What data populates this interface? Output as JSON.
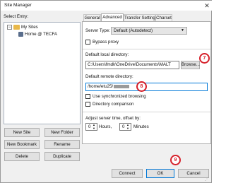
{
  "window": {
    "title": "Site Manager"
  },
  "sidebar": {
    "label": "Select Entry:",
    "tree": {
      "root": "My Sites",
      "child": "Home @ TECFA"
    },
    "buttons": {
      "new_site": "New Site",
      "new_folder": "New Folder",
      "new_bookmark": "New Bookmark",
      "rename": "Rename",
      "delete": "Delete",
      "duplicate": "Duplicate"
    }
  },
  "tabs": [
    "General",
    "Advanced",
    "Transfer Settings",
    "Charset"
  ],
  "active_tab": "Advanced",
  "advanced": {
    "server_type_label": "Server Type:",
    "server_type_value": "Default (Autodetect)",
    "bypass_proxy": "Bypass proxy",
    "local_dir_label": "Default local directory:",
    "local_dir_value": "C:\\Users\\fmdk\\OneDrive\\Documents\\MALT",
    "browse_button": "Browse...",
    "remote_dir_label": "Default remote directory:",
    "remote_dir_value": "/home/etu25/",
    "sync_browsing": "Use synchronized browsing",
    "dir_comparison": "Directory comparison",
    "time_offset_label": "Adjust server time, offset by:",
    "hours_value": "0",
    "hours_label": "Hours,",
    "minutes_value": "0",
    "minutes_label": "Minutes"
  },
  "footer": {
    "connect": "Connect",
    "ok": "OK",
    "cancel": "Cancel"
  },
  "markers": {
    "browse": "7",
    "remote": "8",
    "ok": "9"
  },
  "colors": {
    "accent": "#d6202a",
    "active_border": "#0078d7",
    "folder": "#e8b84a"
  }
}
